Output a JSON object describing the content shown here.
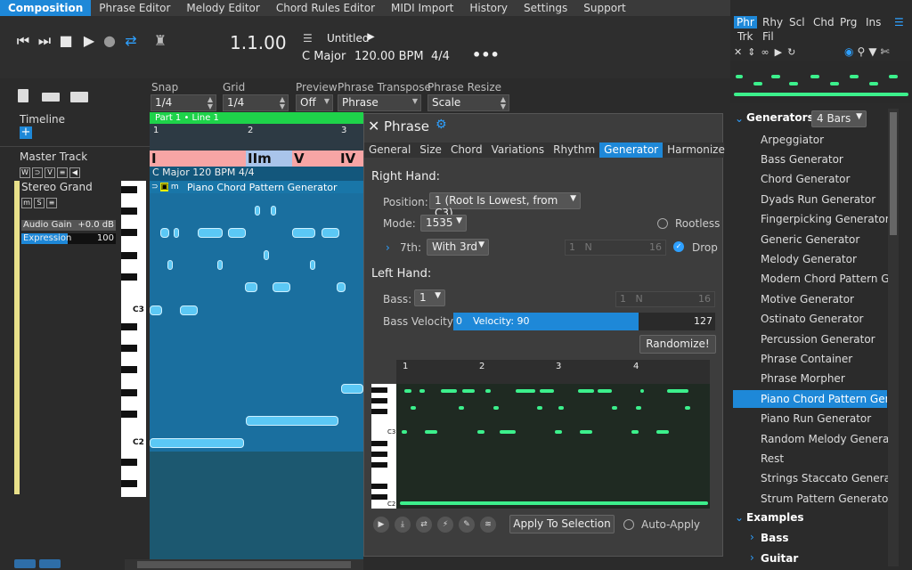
{
  "menubar": {
    "items": [
      "Composition",
      "Phrase Editor",
      "Melody Editor",
      "Chord Rules Editor",
      "MIDI Import",
      "History",
      "Settings",
      "Support"
    ]
  },
  "transport": {
    "position": "1.1.00",
    "song_title": "Untitled",
    "key": "C Major",
    "tempo": "120.00 BPM",
    "time_sig": "4/4"
  },
  "controls": {
    "snap_label": "Snap",
    "snap_value": "1/4",
    "grid_label": "Grid",
    "grid_value": "1/4",
    "preview_label": "Preview",
    "preview_value": "Off",
    "transpose_label": "Phrase Transpose",
    "transpose_value": "Phrase",
    "resize_label": "Phrase Resize",
    "resize_value": "Scale"
  },
  "left": {
    "timeline": "Timeline",
    "master_track": "Master Track",
    "track_name": "Stereo Grand",
    "audio_gain_label": "Audio Gain",
    "audio_gain_value": "+0.0 dB",
    "expression_label": "Expression",
    "expression_value": "100"
  },
  "timeline": {
    "part_label": "Part 1 • Line 1",
    "bars": [
      "1",
      "2",
      "3"
    ],
    "chords": [
      "I",
      "IIm",
      "V",
      "IV"
    ],
    "key_tempo": "C Major  120 BPM  4/4",
    "phrase_name": "Piano Chord Pattern Generator",
    "c3": "C3",
    "c2": "C2"
  },
  "phrase": {
    "title": "Phrase",
    "tabs": [
      "General",
      "Size",
      "Chord",
      "Variations",
      "Rhythm",
      "Generator",
      "Harmonize"
    ],
    "active_tab": "Generator",
    "right_hand": "Right Hand:",
    "position_label": "Position:",
    "position_value": "1 (Root Is Lowest, from C3)",
    "mode_label": "Mode:",
    "mode_value": "1535",
    "rootless": "Rootless",
    "seventh_label": "7th:",
    "seventh_value": "With 3rd",
    "rh_n1": "1",
    "rh_n": "N",
    "rh_n2": "16",
    "drop": "Drop",
    "left_hand": "Left Hand:",
    "bass_label": "Bass:",
    "bass_value": "1",
    "lh_n1": "1",
    "lh_n": "N",
    "lh_n2": "16",
    "bass_vel_label": "Bass Velocity:",
    "bass_vel_min": "0",
    "bass_vel_text": "Velocity: 90",
    "bass_vel_max": "127",
    "randomize": "Randomize!",
    "mini_bars": [
      "1",
      "2",
      "3",
      "4"
    ],
    "mini_c3": "C3",
    "mini_c2": "C2",
    "apply": "Apply To Selection",
    "auto_apply": "Auto-Apply"
  },
  "right": {
    "tabs_row1": [
      "Phr",
      "Rhy",
      "Scl",
      "Chd",
      "Prg",
      "Ins"
    ],
    "tabs_row2": [
      "Trk",
      "Fil"
    ],
    "generators_label": "Generators",
    "bars_value": "4 Bars",
    "generators": [
      "Arpeggiator",
      "Bass Generator",
      "Chord Generator",
      "Dyads Run Generator",
      "Fingerpicking Generator",
      "Generic Generator",
      "Melody Generator",
      "Modern Chord Pattern Generator",
      "Motive Generator",
      "Ostinato Generator",
      "Percussion Generator",
      "Phrase Container",
      "Phrase Morpher",
      "Piano Chord Pattern Generator",
      "Piano Run Generator",
      "Random Melody Generator",
      "Rest",
      "Strings Staccato Generator",
      "Strum Pattern Generator"
    ],
    "selected": "Piano Chord Pattern Generator",
    "examples_label": "Examples",
    "examples": [
      "Bass",
      "Guitar"
    ]
  }
}
